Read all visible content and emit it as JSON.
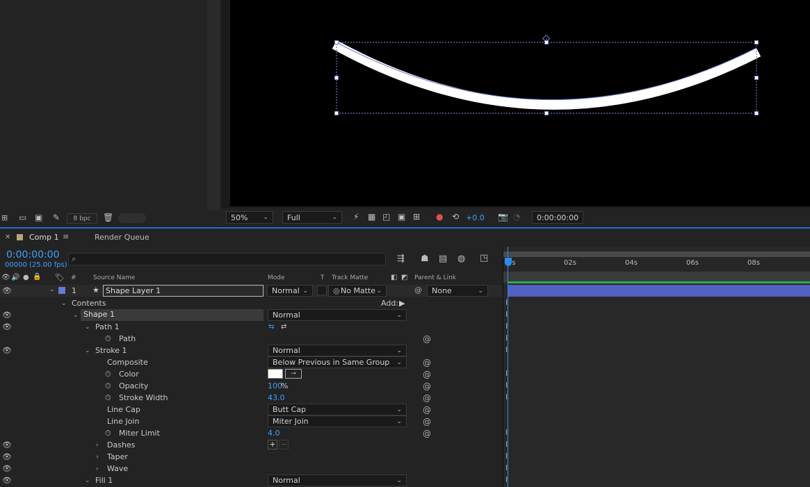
{
  "project": {
    "bpc_label": "8 bpc"
  },
  "viewer": {
    "zoom": "50%",
    "resolution": "Full",
    "exposure": "+0.0",
    "timecode": "0:00:00:00"
  },
  "timeline": {
    "tab_comp": "Comp 1",
    "tab_render": "Render Queue",
    "current_time": "0:00:00:00",
    "frame_info": "00000 (25.00 fps)",
    "search_placeholder": "",
    "columns": {
      "number": "#",
      "source_name": "Source Name",
      "mode": "Mode",
      "t": "T",
      "track_matte": "Track Matte",
      "parent": "Parent & Link"
    },
    "ruler_labels": [
      "0s",
      "02s",
      "04s",
      "06s",
      "08s"
    ],
    "layer": {
      "number": "1",
      "name": "Shape Layer 1",
      "mode": "Normal",
      "matte": "No Matte",
      "parent": "None"
    },
    "contents_label": "Contents",
    "add_label": "Add:",
    "shape_name": "Shape 1",
    "shape_mode": "Normal",
    "path_group": "Path 1",
    "path_prop": "Path",
    "stroke_group": "Stroke 1",
    "stroke_mode": "Normal",
    "composite_label": "Composite",
    "composite_value": "Below Previous in Same Group",
    "color_label": "Color",
    "color_value": "#ffffff",
    "opacity_label": "Opacity",
    "opacity_value": "100",
    "opacity_unit": "%",
    "stroke_width_label": "Stroke Width",
    "stroke_width_value": "43.0",
    "line_cap_label": "Line Cap",
    "line_cap_value": "Butt Cap",
    "line_join_label": "Line Join",
    "line_join_value": "Miter Join",
    "miter_label": "Miter Limit",
    "miter_value": "4.0",
    "dashes_label": "Dashes",
    "taper_label": "Taper",
    "wave_label": "Wave",
    "fill_group": "Fill 1",
    "fill_mode": "Normal"
  },
  "colors": {
    "accent_blue": "#2d8ceb",
    "layer_bar": "#5261c2",
    "label_swatch": "#6878d6"
  }
}
